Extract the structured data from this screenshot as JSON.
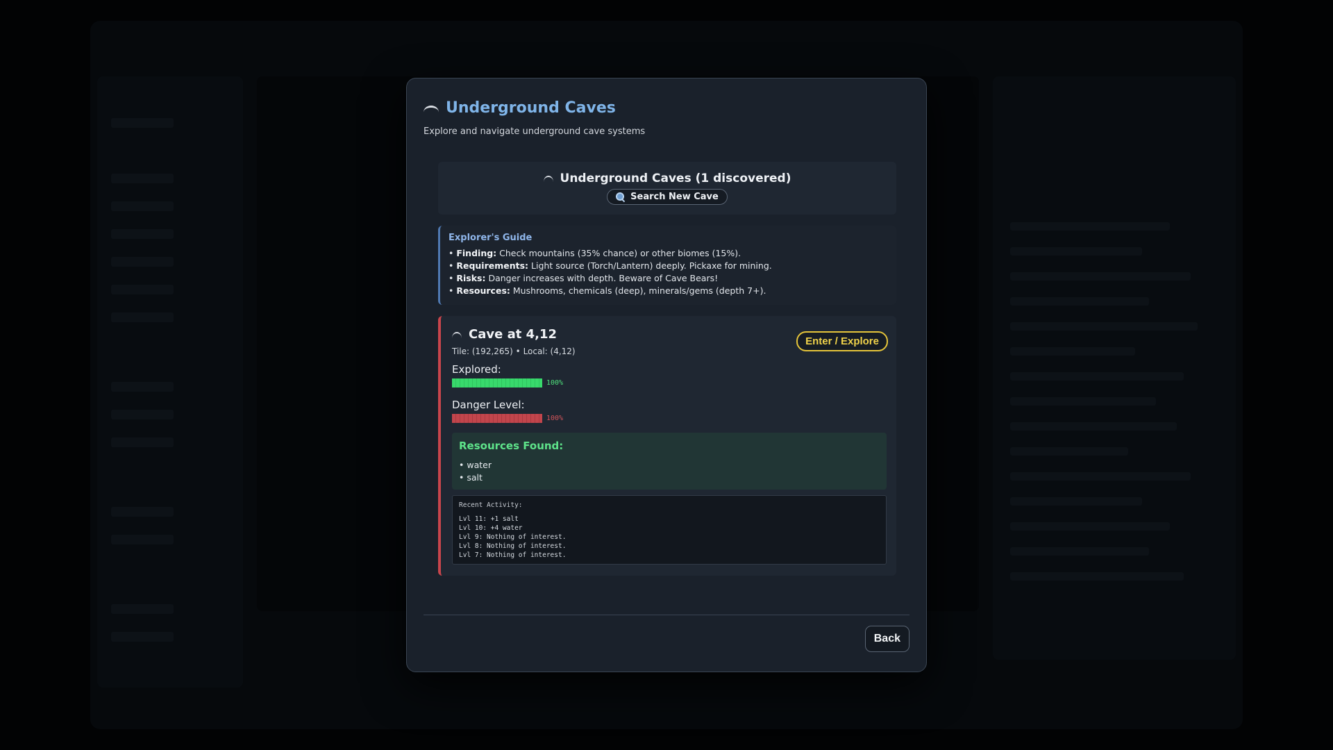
{
  "modal": {
    "title": "Underground Caves",
    "subtitle": "Explore and navigate underground cave systems",
    "back_label": "Back"
  },
  "summary": {
    "title": "Underground Caves (1 discovered)",
    "search_label": "Search New Cave"
  },
  "guide": {
    "title": "Explorer's Guide",
    "items": [
      {
        "label": "Finding:",
        "text": "Check mountains (35% chance) or other biomes (15%)."
      },
      {
        "label": "Requirements:",
        "text": "Light source (Torch/Lantern) deeply. Pickaxe for mining."
      },
      {
        "label": "Risks:",
        "text": "Danger increases with depth. Beware of Cave Bears!"
      },
      {
        "label": "Resources:",
        "text": "Mushrooms, chemicals (deep), minerals/gems (depth 7+)."
      }
    ]
  },
  "cave": {
    "name": "Cave at 4,12",
    "coords": "Tile: (192,265) • Local: (4,12)",
    "enter_label": "Enter / Explore",
    "explored_label": "Explored:",
    "explored_pct": 100,
    "explored_text": "100%",
    "danger_label": "Danger Level:",
    "danger_pct": 100,
    "danger_text": "100%",
    "resources_title": "Resources Found:",
    "resources": [
      "• water",
      "• salt"
    ],
    "activity_title": "Recent Activity:",
    "activity": [
      "Lvl 11: +1 salt",
      "Lvl 10: +4 water",
      "Lvl 9: Nothing of interest.",
      "Lvl 8: Nothing of interest.",
      "Lvl 7: Nothing of interest."
    ]
  },
  "colors": {
    "accent_title": "#7fb4e8",
    "explored_bar": "#38d96c",
    "danger_bar": "#c2454c",
    "enter_button": "#e6c53a",
    "resources_title": "#5ee38a"
  },
  "icons": {
    "cave": "cave-icon",
    "search": "search-icon"
  }
}
